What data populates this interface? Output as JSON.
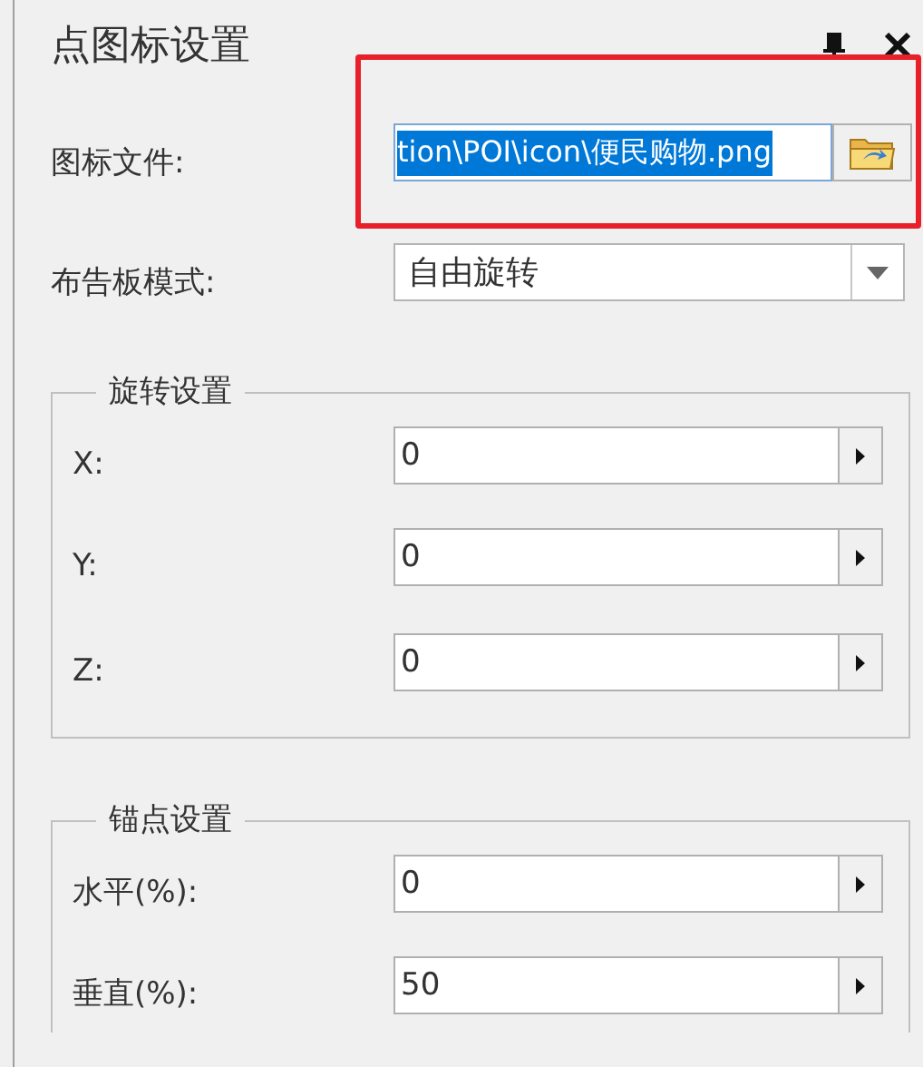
{
  "panel": {
    "title": "点图标设置"
  },
  "icon_file": {
    "label": "图标文件:",
    "value": "tion\\POI\\icon\\便民购物.png",
    "selected": true,
    "highlighted": true
  },
  "billboard_mode": {
    "label": "布告板模式:",
    "value": "自由旋转"
  },
  "groups": [
    {
      "title": "旋转设置",
      "fields": [
        {
          "label": "X:",
          "value": "0"
        },
        {
          "label": "Y:",
          "value": "0"
        },
        {
          "label": "Z:",
          "value": "0"
        }
      ]
    },
    {
      "title": "锚点设置",
      "fields": [
        {
          "label": "水平(%):",
          "value": "0"
        },
        {
          "label": "垂直(%):",
          "value": "50"
        }
      ]
    }
  ]
}
